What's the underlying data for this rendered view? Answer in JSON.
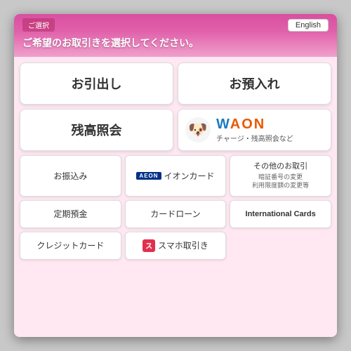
{
  "header": {
    "title_bar": "ご選択",
    "prompt": "ご希望のお取引きを選択してください。",
    "english_button": "English"
  },
  "main_buttons": [
    {
      "id": "withdraw",
      "label": "お引出し"
    },
    {
      "id": "deposit",
      "label": "お預入れ"
    },
    {
      "id": "balance",
      "label": "残高照会"
    }
  ],
  "waon_button": {
    "dog_emoji": "🐶",
    "brand_w": "W",
    "brand_rest": "AON",
    "subtitle": "チャージ・残高照会など"
  },
  "sub_buttons": [
    {
      "id": "transfer",
      "label": "お振込み",
      "icon": ""
    },
    {
      "id": "ion-card",
      "label": "イオンカード",
      "icon": "aeon"
    },
    {
      "id": "other",
      "label": "その他のお取引",
      "sub": "暗証番号の変更\n利用限度額の変更等",
      "icon": ""
    },
    {
      "id": "fixed-deposit",
      "label": "定期預金",
      "icon": ""
    },
    {
      "id": "card-loan",
      "label": "カードローン",
      "icon": ""
    },
    {
      "id": "intl-cards",
      "label": "International Cards",
      "icon": ""
    },
    {
      "id": "credit-card",
      "label": "クレジットカード",
      "icon": ""
    },
    {
      "id": "smaho",
      "label": "スマホ取引き",
      "icon": "smaho"
    }
  ],
  "colors": {
    "header_gradient_start": "#d94fa0",
    "header_gradient_end": "#f0a0cc",
    "waon_orange": "#e85a00",
    "waon_blue": "#1a7bbf",
    "aeon_blue": "#003087",
    "smaho_red": "#e0304e"
  }
}
